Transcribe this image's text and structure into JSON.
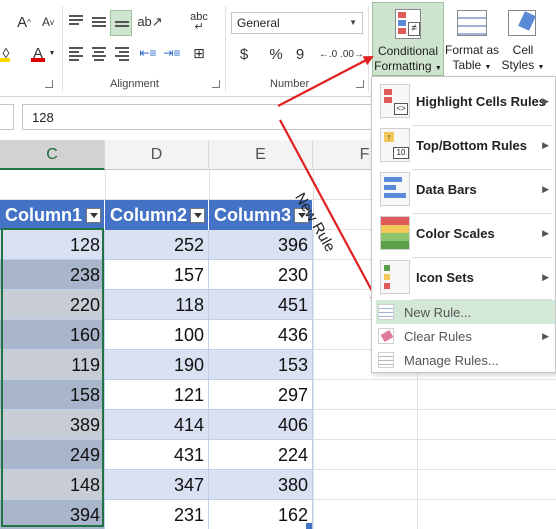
{
  "ribbon": {
    "groups": {
      "alignment": "Alignment",
      "number": "Number"
    },
    "number_format": "General",
    "symbols": {
      "currency": "$",
      "percent": "%",
      "comma": "9",
      "font_a": "A",
      "abc": "abc"
    },
    "conditional_formatting": {
      "line1": "Conditional",
      "line2": "Formatting"
    },
    "format_as_table": {
      "line1": "Format as",
      "line2": "Table"
    },
    "cell_styles": {
      "line1": "Cell",
      "line2": "Styles"
    }
  },
  "formula_bar": {
    "value": "128"
  },
  "columns": [
    "C",
    "D",
    "E",
    "F"
  ],
  "table": {
    "headers": [
      "Column1",
      "Column2",
      "Column3"
    ],
    "rows": [
      [
        128,
        252,
        396
      ],
      [
        238,
        157,
        230
      ],
      [
        220,
        118,
        451
      ],
      [
        160,
        100,
        436
      ],
      [
        119,
        190,
        153
      ],
      [
        158,
        121,
        297
      ],
      [
        389,
        414,
        406
      ],
      [
        249,
        431,
        224
      ],
      [
        148,
        347,
        380
      ],
      [
        394,
        231,
        162
      ]
    ]
  },
  "menu": {
    "items": [
      {
        "label": "Highlight Cells Rules",
        "icon": "highlight-cells-icon",
        "submenu": true
      },
      {
        "label": "Top/Bottom Rules",
        "icon": "top-bottom-icon",
        "submenu": true
      },
      {
        "label": "Data Bars",
        "icon": "data-bars-icon",
        "submenu": true
      },
      {
        "label": "Color Scales",
        "icon": "color-scales-icon",
        "submenu": true
      },
      {
        "label": "Icon Sets",
        "icon": "icon-sets-icon",
        "submenu": true
      },
      {
        "label": "New Rule...",
        "icon": "new-rule-icon",
        "submenu": false
      },
      {
        "label": "Clear Rules",
        "icon": "clear-rules-icon",
        "submenu": true
      },
      {
        "label": "Manage Rules...",
        "icon": "manage-rules-icon",
        "submenu": false
      }
    ]
  },
  "annotation": {
    "text": "New Rule",
    "color": "#e02020"
  },
  "colors": {
    "table_header": "#4472c4",
    "band_light": "#d9e1f2",
    "band_dark": "#a9b5cb",
    "selected_band_light": "#c8ccd5",
    "cf_button": "#cfe4cf",
    "menu_hover": "#d3e8d6",
    "selection_border": "#217346"
  }
}
